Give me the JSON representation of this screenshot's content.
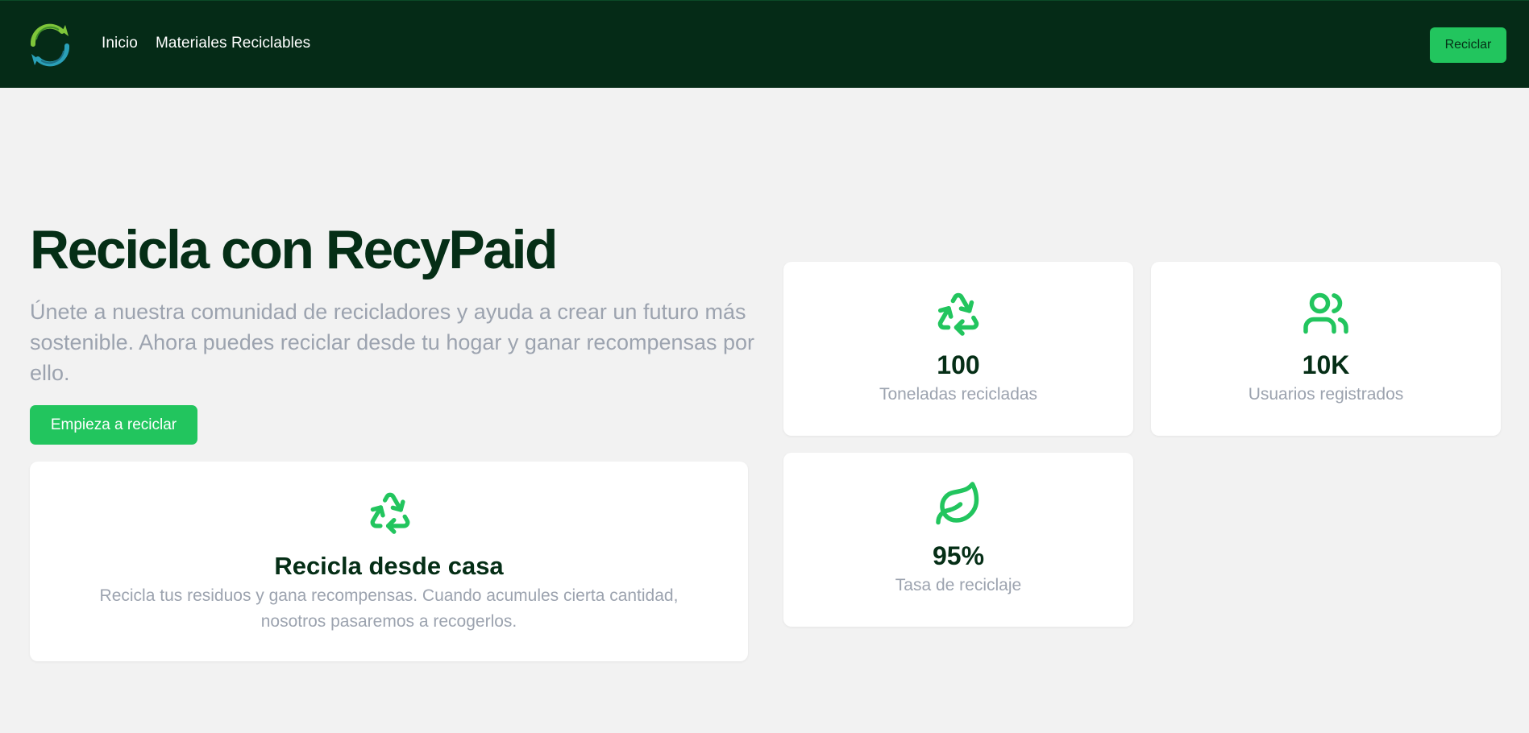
{
  "nav": {
    "logo_icon": "recycle-circle-logo",
    "links": [
      "Inicio",
      "Materiales Reciclables"
    ],
    "cta_label": "Reciclar"
  },
  "hero": {
    "title": "Recicla con RecyPaid",
    "description": "Únete a nuestra comunidad de recicladores y ayuda a crear un futuro más sostenible. Ahora puedes reciclar desde tu hogar y ganar recompensas por ello.",
    "cta_label": "Empieza a reciclar"
  },
  "feature": {
    "icon": "recycle-icon",
    "title": "Recicla desde casa",
    "description": "Recicla tus residuos y gana recompensas. Cuando acumules cierta cantidad, nosotros pasaremos a recogerlos."
  },
  "stats": [
    {
      "icon": "recycle-icon",
      "value": "100",
      "label": "Toneladas recicladas"
    },
    {
      "icon": "users-icon",
      "value": "10K",
      "label": "Usuarios registrados"
    },
    {
      "icon": "leaf-icon",
      "value": "95%",
      "label": "Tasa de reciclaje"
    }
  ],
  "colors": {
    "navbar": "#052b17",
    "accent": "#22c55e",
    "heading": "#052e16",
    "muted": "#9ca3af",
    "background": "#f2f2f2"
  }
}
